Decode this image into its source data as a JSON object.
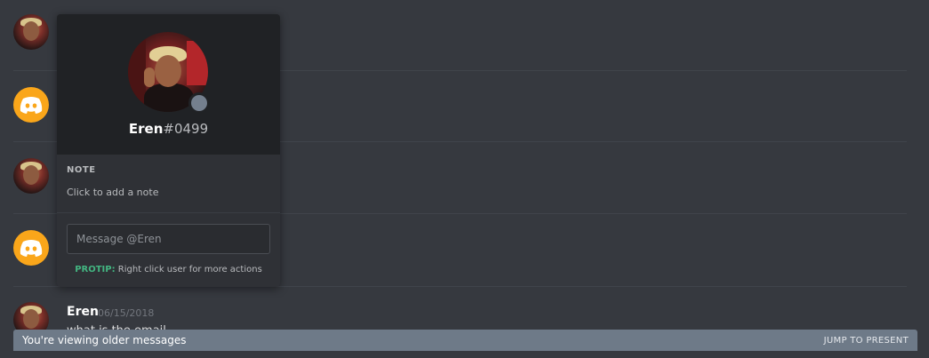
{
  "popout": {
    "username": "Eren",
    "discriminator": "#0499",
    "status": "offline",
    "note_title": "NOTE",
    "note_placeholder": "Click to add a note",
    "message_placeholder": "Message @Eren",
    "protip_label": "PROTIP:",
    "protip_text": " Right click user for more actions"
  },
  "messages": {
    "author": "Eren",
    "timestamp": "06/15/2018",
    "line1": "what is the email",
    "line2": ""
  },
  "older_bar": {
    "text": "You're viewing older messages",
    "jump_label": "JUMP TO PRESENT"
  },
  "colors": {
    "background": "#36393f",
    "discord_orange": "#faa61a",
    "protip_green": "#43b581",
    "older_bar": "#6e7a88"
  },
  "icons": [
    "discord-logo-icon",
    "status-offline-icon"
  ]
}
